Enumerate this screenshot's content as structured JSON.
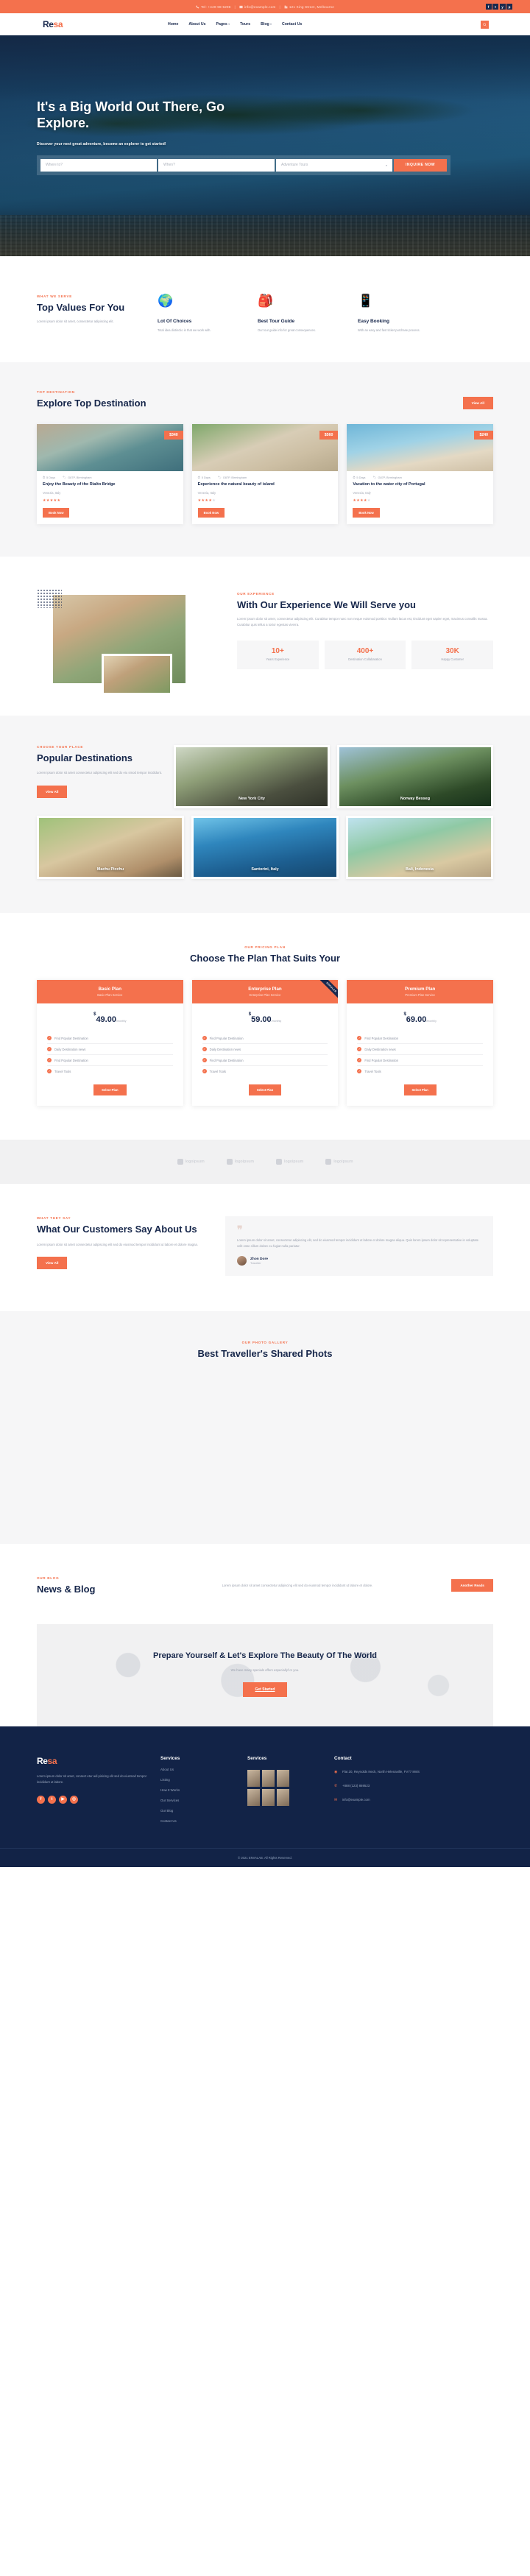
{
  "topbar": {
    "phone": "Tel: +440-98-5298",
    "email": "info@example.com",
    "address": "121 King Street, Melbourne",
    "separator": "|",
    "socials": [
      "f",
      "t",
      "y",
      "p"
    ]
  },
  "nav": {
    "logo_a": "Re",
    "logo_b": "sa",
    "items": [
      {
        "label": "Home",
        "caret": ""
      },
      {
        "label": "About Us",
        "caret": ""
      },
      {
        "label": "Pages",
        "caret": "▾"
      },
      {
        "label": "Tours",
        "caret": ""
      },
      {
        "label": "Blog",
        "caret": "▾"
      },
      {
        "label": "Contact Us",
        "caret": ""
      }
    ]
  },
  "hero": {
    "title": "It's a Big World Out There, Go Explore.",
    "subtitle": "Discover your next great adventure, become an explorer to get started!",
    "search": {
      "where_placeholder": "Where to?",
      "when_placeholder": "When?",
      "type_value": "Adventure Tours",
      "caret": "▾",
      "button": "INQUIRE NOW"
    }
  },
  "values": {
    "kicker": "WHAT WE SERVE",
    "title": "Top Values For You",
    "desc": "Lorem ipsum dolor sit amet, consectetur adipiscing elit.",
    "cards": [
      {
        "icon": "🌍",
        "title": "Lot Of Choices",
        "desc": "Total idea distinctio in that we work with."
      },
      {
        "icon": "🎒",
        "title": "Best Tour Guide",
        "desc": "Our tour guide info for great consequences."
      },
      {
        "icon": "📱",
        "title": "Easy Booking",
        "desc": "With an easy and fast ticket purchase process."
      }
    ]
  },
  "destination": {
    "kicker": "TOP DESTINATION",
    "title": "Explore Top Destination",
    "view_all": "View All",
    "cards": [
      {
        "price": "$340",
        "days": "5 Days",
        "code": "G87P, Birmingham",
        "title": "Enjoy the Beauty of the Rialto Bridge",
        "location": "Venezia, Italy",
        "stars": 5,
        "button": "Book Now"
      },
      {
        "price": "$560",
        "days": "5 Days",
        "code": "G87P, Birmingham",
        "title": "Experience the natural beauty of island",
        "location": "Venezia, Italy",
        "stars": 4,
        "button": "Book Now"
      },
      {
        "price": "$240",
        "days": "5 Days",
        "code": "G87P, Birmingham",
        "title": "Vacation to the water city of Portugal",
        "location": "Venezia, Italy",
        "stars": 4,
        "button": "Book Now"
      }
    ]
  },
  "experience": {
    "kicker": "OUR EXPERIENCE",
    "title": "With Our Experience We Will Serve you",
    "desc": "Lorem ipsum dolor sit amet, consectetur adipiscing elit. Curabitur tempor nunc non neque euismod porttitor. Nullam lacus est, tincidunt eget sapien eget, maximus convallis massa. Curabitur quis tellus a tortor egestas viverra.",
    "stats": [
      {
        "value": "10+",
        "label": "Years Experience"
      },
      {
        "value": "400+",
        "label": "Destination Collabaration"
      },
      {
        "value": "30K",
        "label": "Happy Customer"
      }
    ]
  },
  "popular": {
    "kicker": "CHOOSE YOUR PLACE",
    "title": "Popular Destinations",
    "desc": "Lorem ipsum dolor sit amet consectetur adipiscing elit sed do eiu smod tempor incididunt.",
    "view_all": "View All",
    "tiles_top": [
      {
        "caption": "New York City"
      },
      {
        "caption": "Norway Besseg"
      }
    ],
    "tiles_bottom": [
      {
        "caption": "Machu Picchu"
      },
      {
        "caption": "Santorini, Italy"
      },
      {
        "caption": "Bali, Indonesia"
      }
    ]
  },
  "pricing": {
    "kicker": "OUR PRICING PLAN",
    "title": "Choose The Plan That Suits Your",
    "popular_badge": "POPULAR",
    "plans": [
      {
        "name": "Basic Plan",
        "sub": "Basic Plan Service",
        "currency": "$",
        "amount": "49.00",
        "per": "/monthly",
        "features": [
          "Find Popular Destination",
          "Daily Destination news",
          "Find Popular Destination",
          "Travel Tools"
        ],
        "button": "Select Plan",
        "popular": false
      },
      {
        "name": "Enterprise Plan",
        "sub": "Enterprise Plan Service",
        "currency": "$",
        "amount": "59.00",
        "per": "/monthly",
        "features": [
          "Find Popular Destination",
          "Daily Destination news",
          "Find Popular Destination",
          "Travel Tools"
        ],
        "button": "Select Plan",
        "popular": true
      },
      {
        "name": "Premium Plan",
        "sub": "Premium Plan Service",
        "currency": "$",
        "amount": "69.00",
        "per": "/monthly",
        "features": [
          "Find Popular Destination",
          "Daily Destination news",
          "Find Popular Destination",
          "Travel Tools"
        ],
        "button": "Select Plan",
        "popular": false
      }
    ]
  },
  "brands": [
    {
      "name": "logoipsum"
    },
    {
      "name": "logoipsum"
    },
    {
      "name": "logoipsum"
    },
    {
      "name": "logoipsum"
    }
  ],
  "testimonial": {
    "kicker": "WHAT THEY SAY",
    "title": "What Our Customers Say About Us",
    "desc": "Lorem ipsum dolor sit amet consectetur adipiscing elit sed do eiusmod tempor incididunt ut labore et dolore magna.",
    "view_all": "View All",
    "quote_mark": "❞",
    "quote": "Lorem ipsum dolor sit amet, consectetur adipiscing elit, sed do eiusmod tempor incididunt ut labore et dolore magna aliqua. Quis lorem ipsum dolor sit representative in voluptate velit esse cillum dolore eu fugiat nulla pariatur.",
    "author": "Zhon Dore",
    "role": "Traveller"
  },
  "gallery": {
    "kicker": "OUR PHOTO GALLERY",
    "title": "Best Traveller's Shared Phots"
  },
  "blog": {
    "kicker": "OUR BLOG",
    "title": "News & Blog",
    "desc": "Lorem ipsum dolor sit amet consectetur adipiscing elit sed do eiusmod tempor incididunt ut labore et dolore.",
    "button": "Another Reads"
  },
  "cta": {
    "title": "Prepare Yourself & Let's Explore The Beauty Of The World",
    "desc": "We have many specials offers especiallyf or you.",
    "button": "Get Started"
  },
  "footer": {
    "logo_a": "Re",
    "logo_b": "sa",
    "desc": "Lorem ipsum dolor sit amet, consect etur adi pisicing elit sed do eiusmod tempor incididunt ut labore.",
    "socials": [
      "f",
      "t",
      "▶",
      "◎"
    ],
    "col1": {
      "title": "Services",
      "links": [
        "About Us",
        "Listing",
        "How It Works",
        "Our Services",
        "Our Blog",
        "Contact Us"
      ]
    },
    "col2": {
      "title": "Services"
    },
    "contact": {
      "title": "Contact",
      "address": "Flat 20, Reynolds Neck, North Helenaville, FV77 8WS",
      "phone": "+888 (123) 869523",
      "email": "info@example.com",
      "icons": {
        "pin": "◉",
        "phone": "✆",
        "mail": "✉"
      }
    },
    "copyright": "© 2021 ENVALAB. All Rights Reserved."
  }
}
